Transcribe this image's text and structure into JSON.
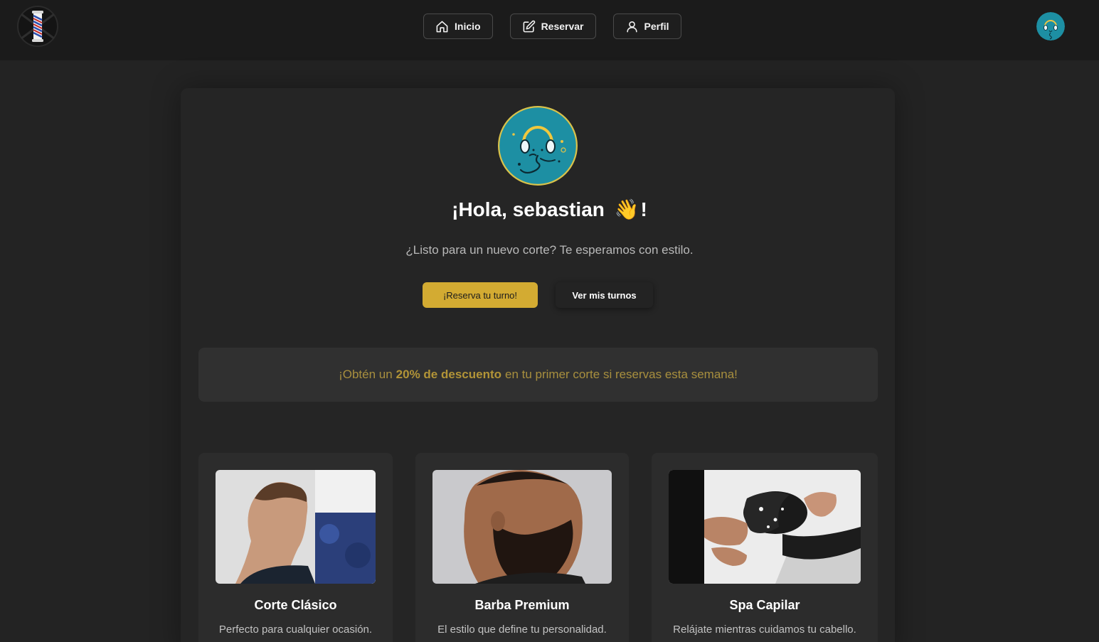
{
  "nav": {
    "items": [
      {
        "label": "Inicio",
        "icon": "home-icon"
      },
      {
        "label": "Reservar",
        "icon": "edit-icon"
      },
      {
        "label": "Perfil",
        "icon": "user-icon"
      }
    ]
  },
  "hero": {
    "greeting_prefix": "¡Hola, sebastian",
    "wave_emoji": "👋",
    "greeting_suffix": "!",
    "subtitle": "¿Listo para un nuevo corte? Te esperamos con estilo.",
    "primary_cta": "¡Reserva tu turno!",
    "secondary_cta": "Ver mis turnos"
  },
  "promo": {
    "before": "¡Obtén un",
    "highlight": "20% de descuento",
    "after": "en tu primer corte si reservas esta semana!"
  },
  "services": [
    {
      "title": "Corte Clásico",
      "description": "Perfecto para cualquier ocasión."
    },
    {
      "title": "Barba Premium",
      "description": "El estilo que define tu personalidad."
    },
    {
      "title": "Spa Capilar",
      "description": "Relájate mientras cuidamos tu cabello."
    }
  ],
  "colors": {
    "background": "#232323",
    "topbar": "#1b1b1b",
    "accent_gold": "#d3ab32",
    "avatar_teal": "#1d8fa3"
  }
}
